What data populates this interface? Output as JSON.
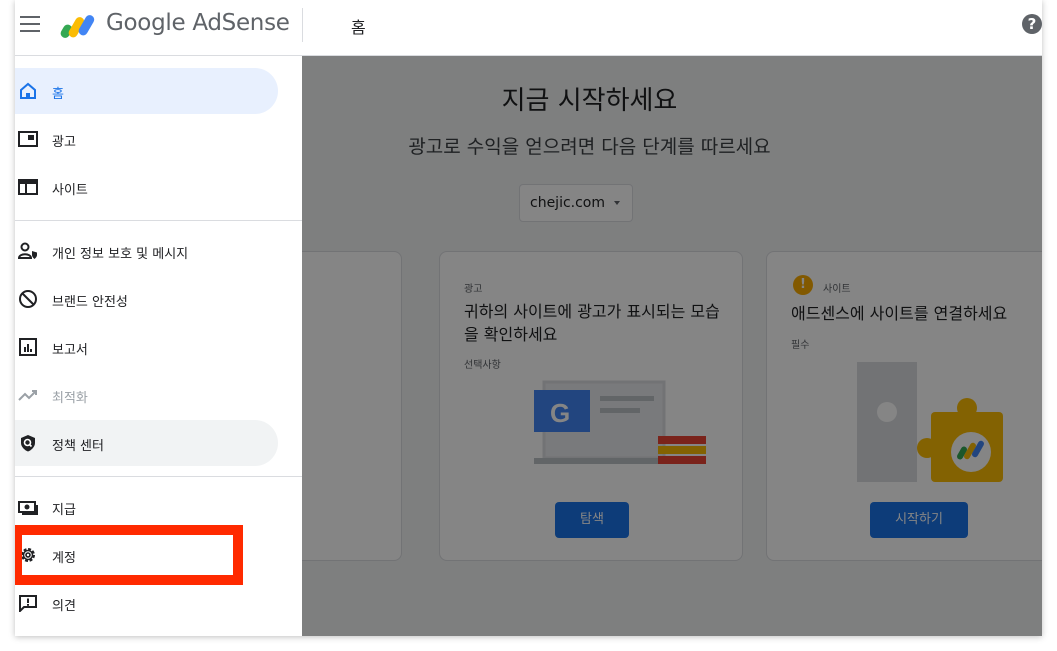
{
  "app": {
    "logo_text": "Google AdSense",
    "page_title": "홈",
    "help_glyph": "?"
  },
  "sidebar": {
    "items": [
      {
        "label": "홈",
        "icon": "home-icon"
      },
      {
        "label": "광고",
        "icon": "ads-icon"
      },
      {
        "label": "사이트",
        "icon": "sites-icon"
      },
      {
        "label": "개인 정보 보호 및 메시지",
        "icon": "privacy-icon"
      },
      {
        "label": "브랜드 안전성",
        "icon": "block-icon"
      },
      {
        "label": "보고서",
        "icon": "reports-icon"
      },
      {
        "label": "최적화",
        "icon": "optimize-icon"
      },
      {
        "label": "정책 센터",
        "icon": "policy-shield-icon"
      },
      {
        "label": "지급",
        "icon": "payments-icon"
      },
      {
        "label": "계정",
        "icon": "gear-icon"
      },
      {
        "label": "의견",
        "icon": "feedback-icon"
      }
    ]
  },
  "main": {
    "title": "지금 시작하세요",
    "subtitle": "광고로 수익을 얻으려면 다음 단계를 따르세요",
    "site_select": {
      "value": "chejic.com"
    },
    "cards": [
      {
        "kicker": "광고",
        "title": "귀하의 사이트에 광고가 표시되는 모습을 확인하세요",
        "note": "선택사항",
        "button": "탐색"
      },
      {
        "kicker": "사이트",
        "title": "애드센스에 사이트를 연결하세요",
        "note": "필수",
        "button": "시작하기",
        "warn_glyph": "!"
      }
    ]
  },
  "colors": {
    "accent": "#1a73e8",
    "highlight": "#ff2a00",
    "warning": "#f9ab00"
  }
}
